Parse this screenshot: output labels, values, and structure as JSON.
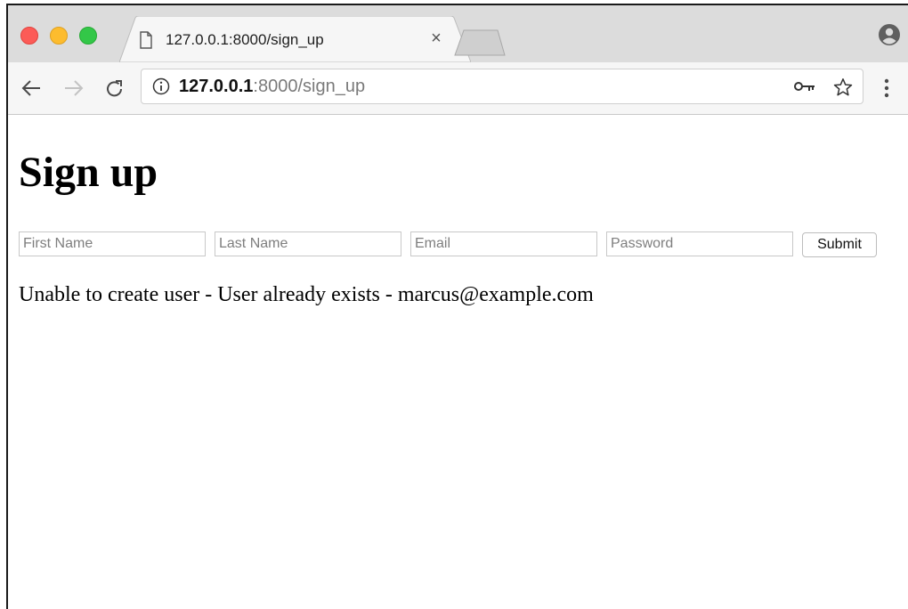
{
  "browser": {
    "tab": {
      "title": "127.0.0.1:8000/sign_up",
      "close_glyph": "×"
    },
    "address_bar": {
      "host": "127.0.0.1",
      "rest": ":8000/sign_up"
    },
    "icons": {
      "back": "back-arrow-icon",
      "forward": "forward-arrow-icon",
      "reload": "reload-icon",
      "info": "info-icon",
      "key": "key-icon",
      "star": "star-icon",
      "menu": "menu-dots-icon",
      "profile": "profile-icon",
      "page": "page-icon"
    },
    "traffic_lights": {
      "close": "#fc5b57",
      "minimize": "#fdbc2e",
      "zoom": "#33c748"
    }
  },
  "page": {
    "heading": "Sign up",
    "form": {
      "first_name": {
        "placeholder": "First Name",
        "value": ""
      },
      "last_name": {
        "placeholder": "Last Name",
        "value": ""
      },
      "email": {
        "placeholder": "Email",
        "value": ""
      },
      "password": {
        "placeholder": "Password",
        "value": ""
      },
      "submit_label": "Submit"
    },
    "message": "Unable to create user - User already exists - marcus@example.com"
  }
}
